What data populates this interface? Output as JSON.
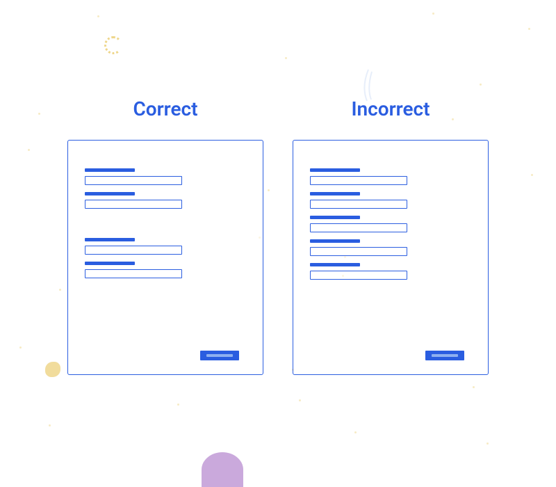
{
  "headings": {
    "correct": "Correct",
    "incorrect": "Incorrect"
  },
  "panels": {
    "correct": {
      "field_count": 4,
      "layout": "grouped"
    },
    "incorrect": {
      "field_count": 5,
      "layout": "uniform"
    }
  },
  "colors": {
    "accent": "#2a5de0",
    "texture": "#e8c55a",
    "purple_accent": "#c19ad6"
  }
}
